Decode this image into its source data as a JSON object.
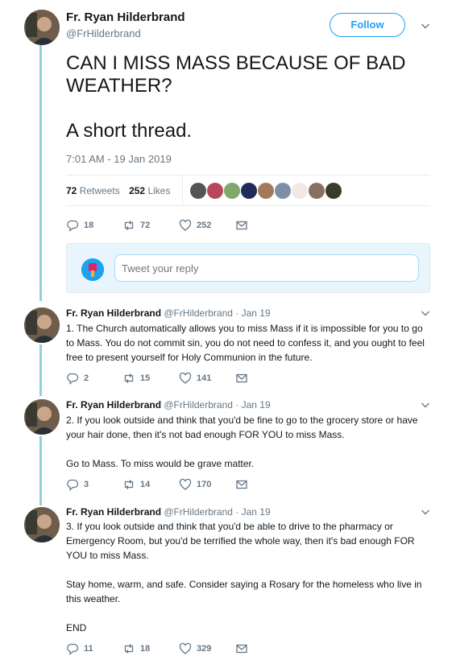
{
  "colors": {
    "accent": "#1da1f2",
    "thread_line": "#8fd2d6",
    "retweet_green": "#17bf63",
    "muted": "#657786"
  },
  "main_tweet": {
    "author_name": "Fr. Ryan Hilderbrand",
    "handle": "@FrHilderbrand",
    "follow_label": "Follow",
    "text_line1": "CAN I MISS MASS BECAUSE OF BAD WEATHER?",
    "text_line2": "A short thread.",
    "timestamp": "7:01 AM - 19 Jan 2019",
    "retweets_count": "72",
    "retweets_label": "Retweets",
    "likes_count": "252",
    "likes_label": "Likes",
    "actions": {
      "replies": "18",
      "retweets": "72",
      "likes": "252"
    }
  },
  "reply_box": {
    "placeholder": "Tweet your reply"
  },
  "replies": [
    {
      "author_name": "Fr. Ryan Hilderbrand",
      "handle": "@FrHilderbrand",
      "date": "· Jan 19",
      "text": "1. The Church automatically allows you to miss Mass if it is impossible for you to go to Mass. You do not commit sin, you do not need to confess it, and you ought to feel free to present yourself for Holy Communion in the future.",
      "actions": {
        "replies": "2",
        "retweets": "15",
        "likes": "141"
      }
    },
    {
      "author_name": "Fr. Ryan Hilderbrand",
      "handle": "@FrHilderbrand",
      "date": "· Jan 19",
      "text_p1": "2. If you look outside and think that you'd be fine to go to the grocery store or have your hair done, then it's not bad enough FOR YOU to miss Mass.",
      "text_p2": "Go to Mass. To miss would be grave matter.",
      "actions": {
        "replies": "3",
        "retweets": "14",
        "likes": "170"
      }
    },
    {
      "author_name": "Fr. Ryan Hilderbrand",
      "handle": "@FrHilderbrand",
      "date": "· Jan 19",
      "text_p1": "3. If you look outside and think that you'd be able to drive to the pharmacy or Emergency Room, but you'd be terrified the whole way, then it's bad enough FOR YOU to miss Mass.",
      "text_p2": "Stay home, warm, and safe. Consider saying a Rosary for the homeless who live in this weather.",
      "text_p3": "END",
      "actions": {
        "replies": "11",
        "retweets": "18",
        "likes": "329"
      }
    }
  ]
}
